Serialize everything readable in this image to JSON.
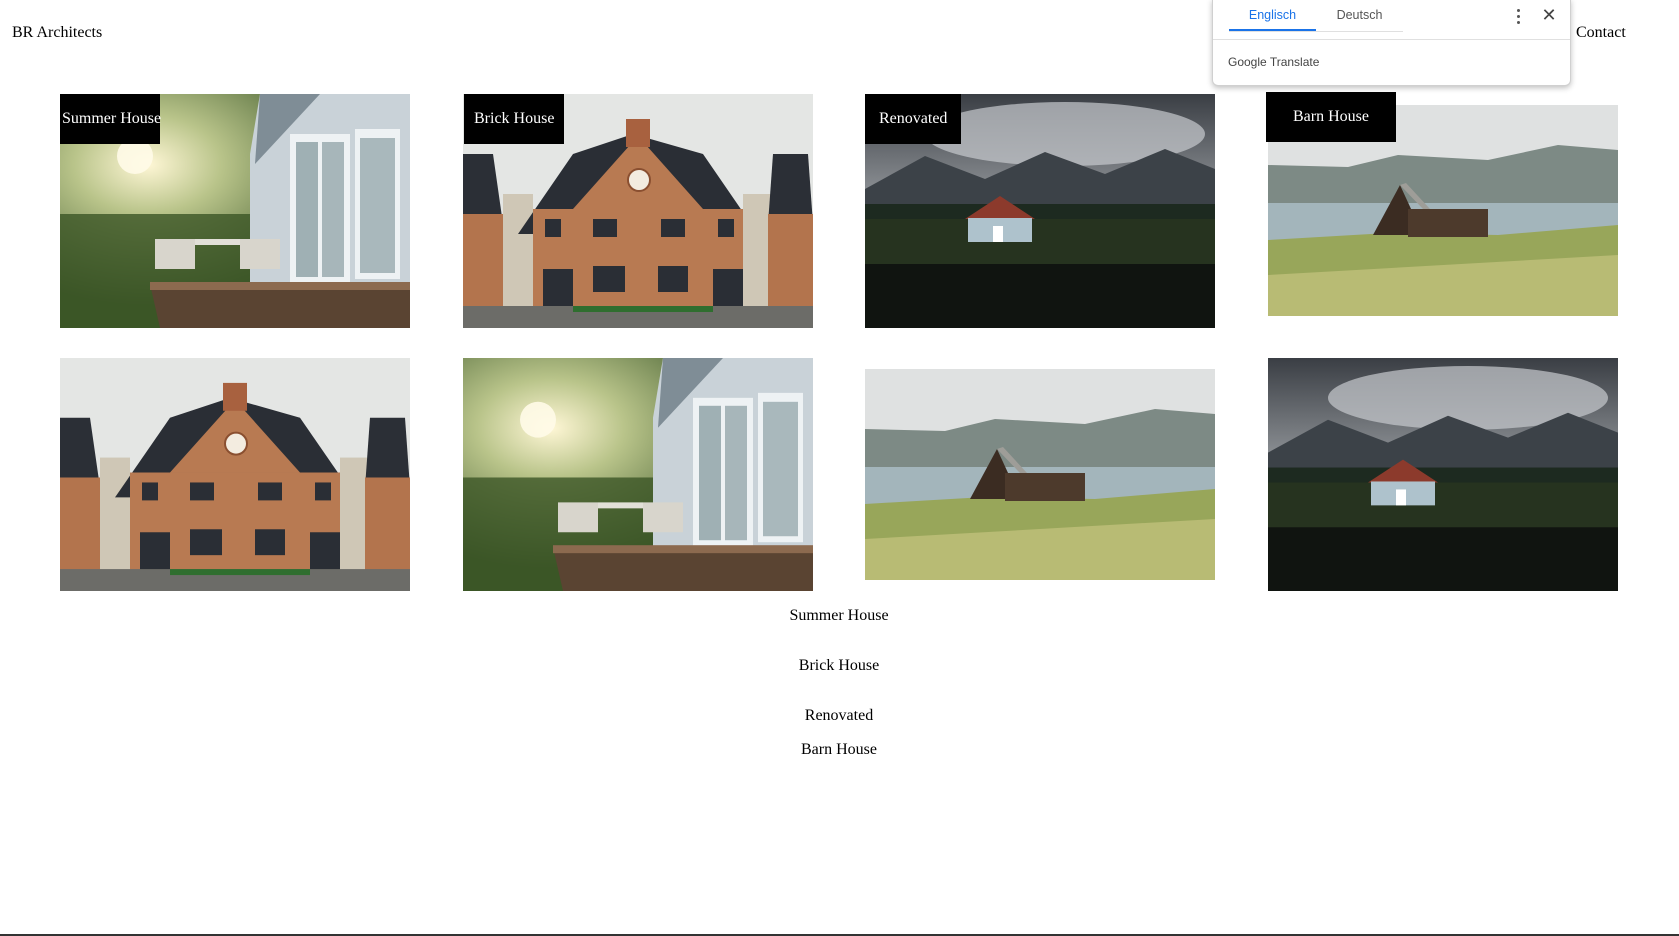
{
  "header": {
    "brand": "BR Architects",
    "contact": "Contact"
  },
  "translate_popup": {
    "tabs": [
      {
        "label": "Englisch",
        "active": true
      },
      {
        "label": "Deutsch",
        "active": false
      }
    ],
    "brand_google": "Google",
    "brand_translate": "Translate",
    "more_icon": "more-vert-icon",
    "close_icon": "close-icon",
    "accent_color": "#1a73e8"
  },
  "gallery": {
    "row1": [
      {
        "label": "Summer House",
        "scene": "summer"
      },
      {
        "label": "Brick House",
        "scene": "brick"
      },
      {
        "label": "Renovated",
        "scene": "renovated"
      },
      {
        "label": "Barn House",
        "scene": "barn"
      }
    ],
    "row2": [
      {
        "scene": "brick"
      },
      {
        "scene": "summer"
      },
      {
        "scene": "barn"
      },
      {
        "scene": "renovated"
      }
    ]
  },
  "captions": [
    "Summer House",
    "Brick House",
    "Renovated",
    "Barn House"
  ]
}
